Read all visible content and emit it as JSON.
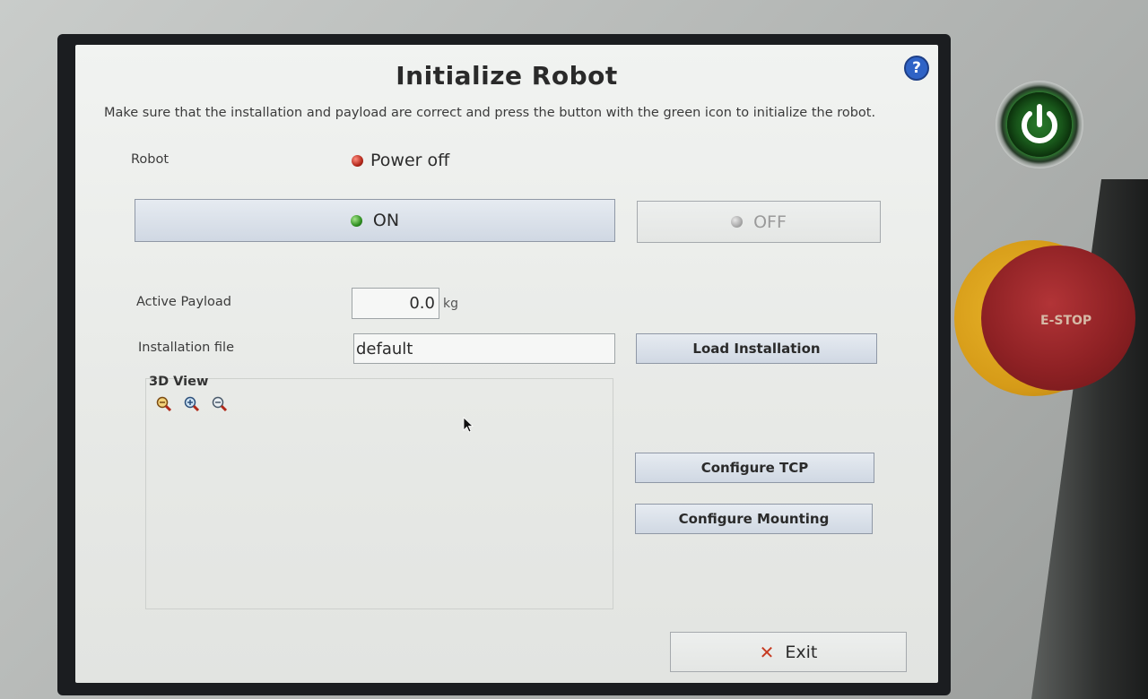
{
  "dialog": {
    "title": "Initialize Robot",
    "subtitle": "Make sure that the installation and payload are correct and press the button with the green icon to initialize the robot.",
    "help_icon": "question-circle-icon"
  },
  "robot": {
    "label": "Robot",
    "status": "Power off",
    "status_color": "#b3281b"
  },
  "power_buttons": {
    "on_label": "ON",
    "off_label": "OFF",
    "on_led_color": "#2f8f21",
    "off_led_color": "#a9a9a9"
  },
  "payload": {
    "label": "Active Payload",
    "value": "0.0",
    "unit": "kg"
  },
  "installation": {
    "label": "Installation file",
    "value": "default",
    "load_button": "Load Installation"
  },
  "view3d": {
    "title": "3D View",
    "zoom_icons": [
      "zoom-out-icon",
      "zoom-in-icon",
      "zoom-reset-icon"
    ]
  },
  "buttons": {
    "configure_tcp": "Configure TCP",
    "configure_mounting": "Configure Mounting",
    "exit": "Exit"
  },
  "hardware": {
    "estop_label": "E-STOP",
    "power_button_icon": "power-icon",
    "power_glow_color": "#36d43a"
  }
}
